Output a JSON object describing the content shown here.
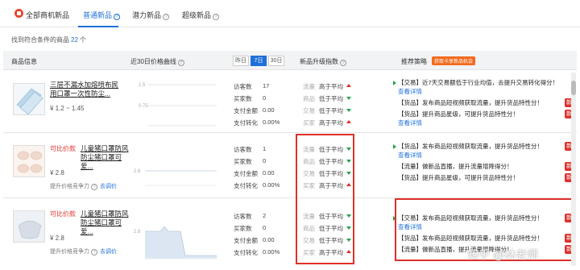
{
  "tabs": [
    {
      "label": "全部商机新品"
    },
    {
      "label": "普通新品"
    },
    {
      "label": "潜力新品"
    },
    {
      "label": "超级新品"
    }
  ],
  "found": {
    "prefix": "找到符合条件的商品",
    "count": "22",
    "suffix": "个"
  },
  "header": {
    "product_info": "商品信息",
    "trend": "近30日价格曲线",
    "days": [
      "昨日",
      "7日",
      "30日"
    ],
    "grade": "新品升级指数",
    "strategy": "推荐策略",
    "opportunity_badge": "获取卡享新品机会"
  },
  "metric_labels": [
    "访客数",
    "买家数",
    "支付金额",
    "支付转化"
  ],
  "grade_labels": [
    "流量",
    "商品",
    "交易",
    "买家"
  ],
  "rows": [
    {
      "title": "三层不漏水加熔喷布民用口罩一次性防尘...",
      "tag": "",
      "price": "¥ 1.2 ~ 1.45",
      "promo": "",
      "promo_link": "",
      "chart_ticks": [
        "1.5",
        "0.75"
      ],
      "metrics": [
        "17",
        "0",
        "0.00",
        "0.00%"
      ],
      "grades": [
        {
          "label": "高于平均",
          "dir": "up"
        },
        {
          "label": "低于平均",
          "dir": "down"
        },
        {
          "label": "低于平均",
          "dir": "down"
        },
        {
          "label": "高于平均",
          "dir": "up"
        }
      ],
      "strategies": [
        {
          "text": "【交易】近7天交易额低于行业均值，去提升交易转化得分！",
          "link": "查看详情",
          "new": ""
        },
        {
          "text": "【货品】发布商品短视频获取流量，提升货品特性分！",
          "link": "",
          "new": "新"
        },
        {
          "text": "【货品】提升商品星级，可提升货品特性分！",
          "link": "查看详情",
          "new": "新"
        }
      ]
    },
    {
      "title": "儿童猪口罩防风防尘猪口罩可爱...",
      "tag": "可比价款",
      "price": "¥ 2.8",
      "promo": "提升价格竞争力",
      "promo_link": "去调价",
      "chart_ticks": [
        "2.8"
      ],
      "metrics": [
        "1",
        "0",
        "0.00",
        "0.00%"
      ],
      "grades": [
        {
          "label": "低于平均",
          "dir": "down"
        },
        {
          "label": "低于平均",
          "dir": "down"
        },
        {
          "label": "低于平均",
          "dir": "down"
        },
        {
          "label": "高于平均",
          "dir": "up"
        }
      ],
      "strategies": [
        {
          "text": "【货品】发布商品短视频获取流量，提升货品特性分！",
          "link": "查看详情",
          "new": "新"
        },
        {
          "text": "【流量】做新品直播，提升流量增降得分！",
          "link": "",
          "new": "新"
        },
        {
          "text": "【货品】提升商品星级，可提升货品特性分！",
          "link": "",
          "new": "新"
        }
      ]
    },
    {
      "title": "儿童猪口罩防风防尘猪口罩可爱...",
      "tag": "可比价款",
      "price": "¥ 2.8",
      "promo": "提升价格竞争力",
      "promo_link": "去调价",
      "chart_ticks": [
        "2.8"
      ],
      "metrics": [
        "2",
        "0",
        "0.00",
        "0.00%"
      ],
      "grades": [
        {
          "label": "低于平均",
          "dir": "down"
        },
        {
          "label": "低于平均",
          "dir": "down"
        },
        {
          "label": "低于平均",
          "dir": "down"
        },
        {
          "label": "高于平均",
          "dir": "up"
        }
      ],
      "strategies": [
        {
          "text": "【交易】发布商品短视频获取流量，提升货品特性分！",
          "link": "查看详情",
          "new": "新"
        },
        {
          "text": "【货品】发布商品短视频获取流量，提升货品特性分！",
          "link": "",
          "new": "新"
        },
        {
          "text": "【流量】做新品直播，提升流量增降得分！",
          "link": "",
          "new": "新"
        }
      ]
    }
  ],
  "watermark": "知乎 @林老师",
  "colors": {
    "accent": "#1f6fd8",
    "red": "#e0302b",
    "green": "#22a84a"
  }
}
